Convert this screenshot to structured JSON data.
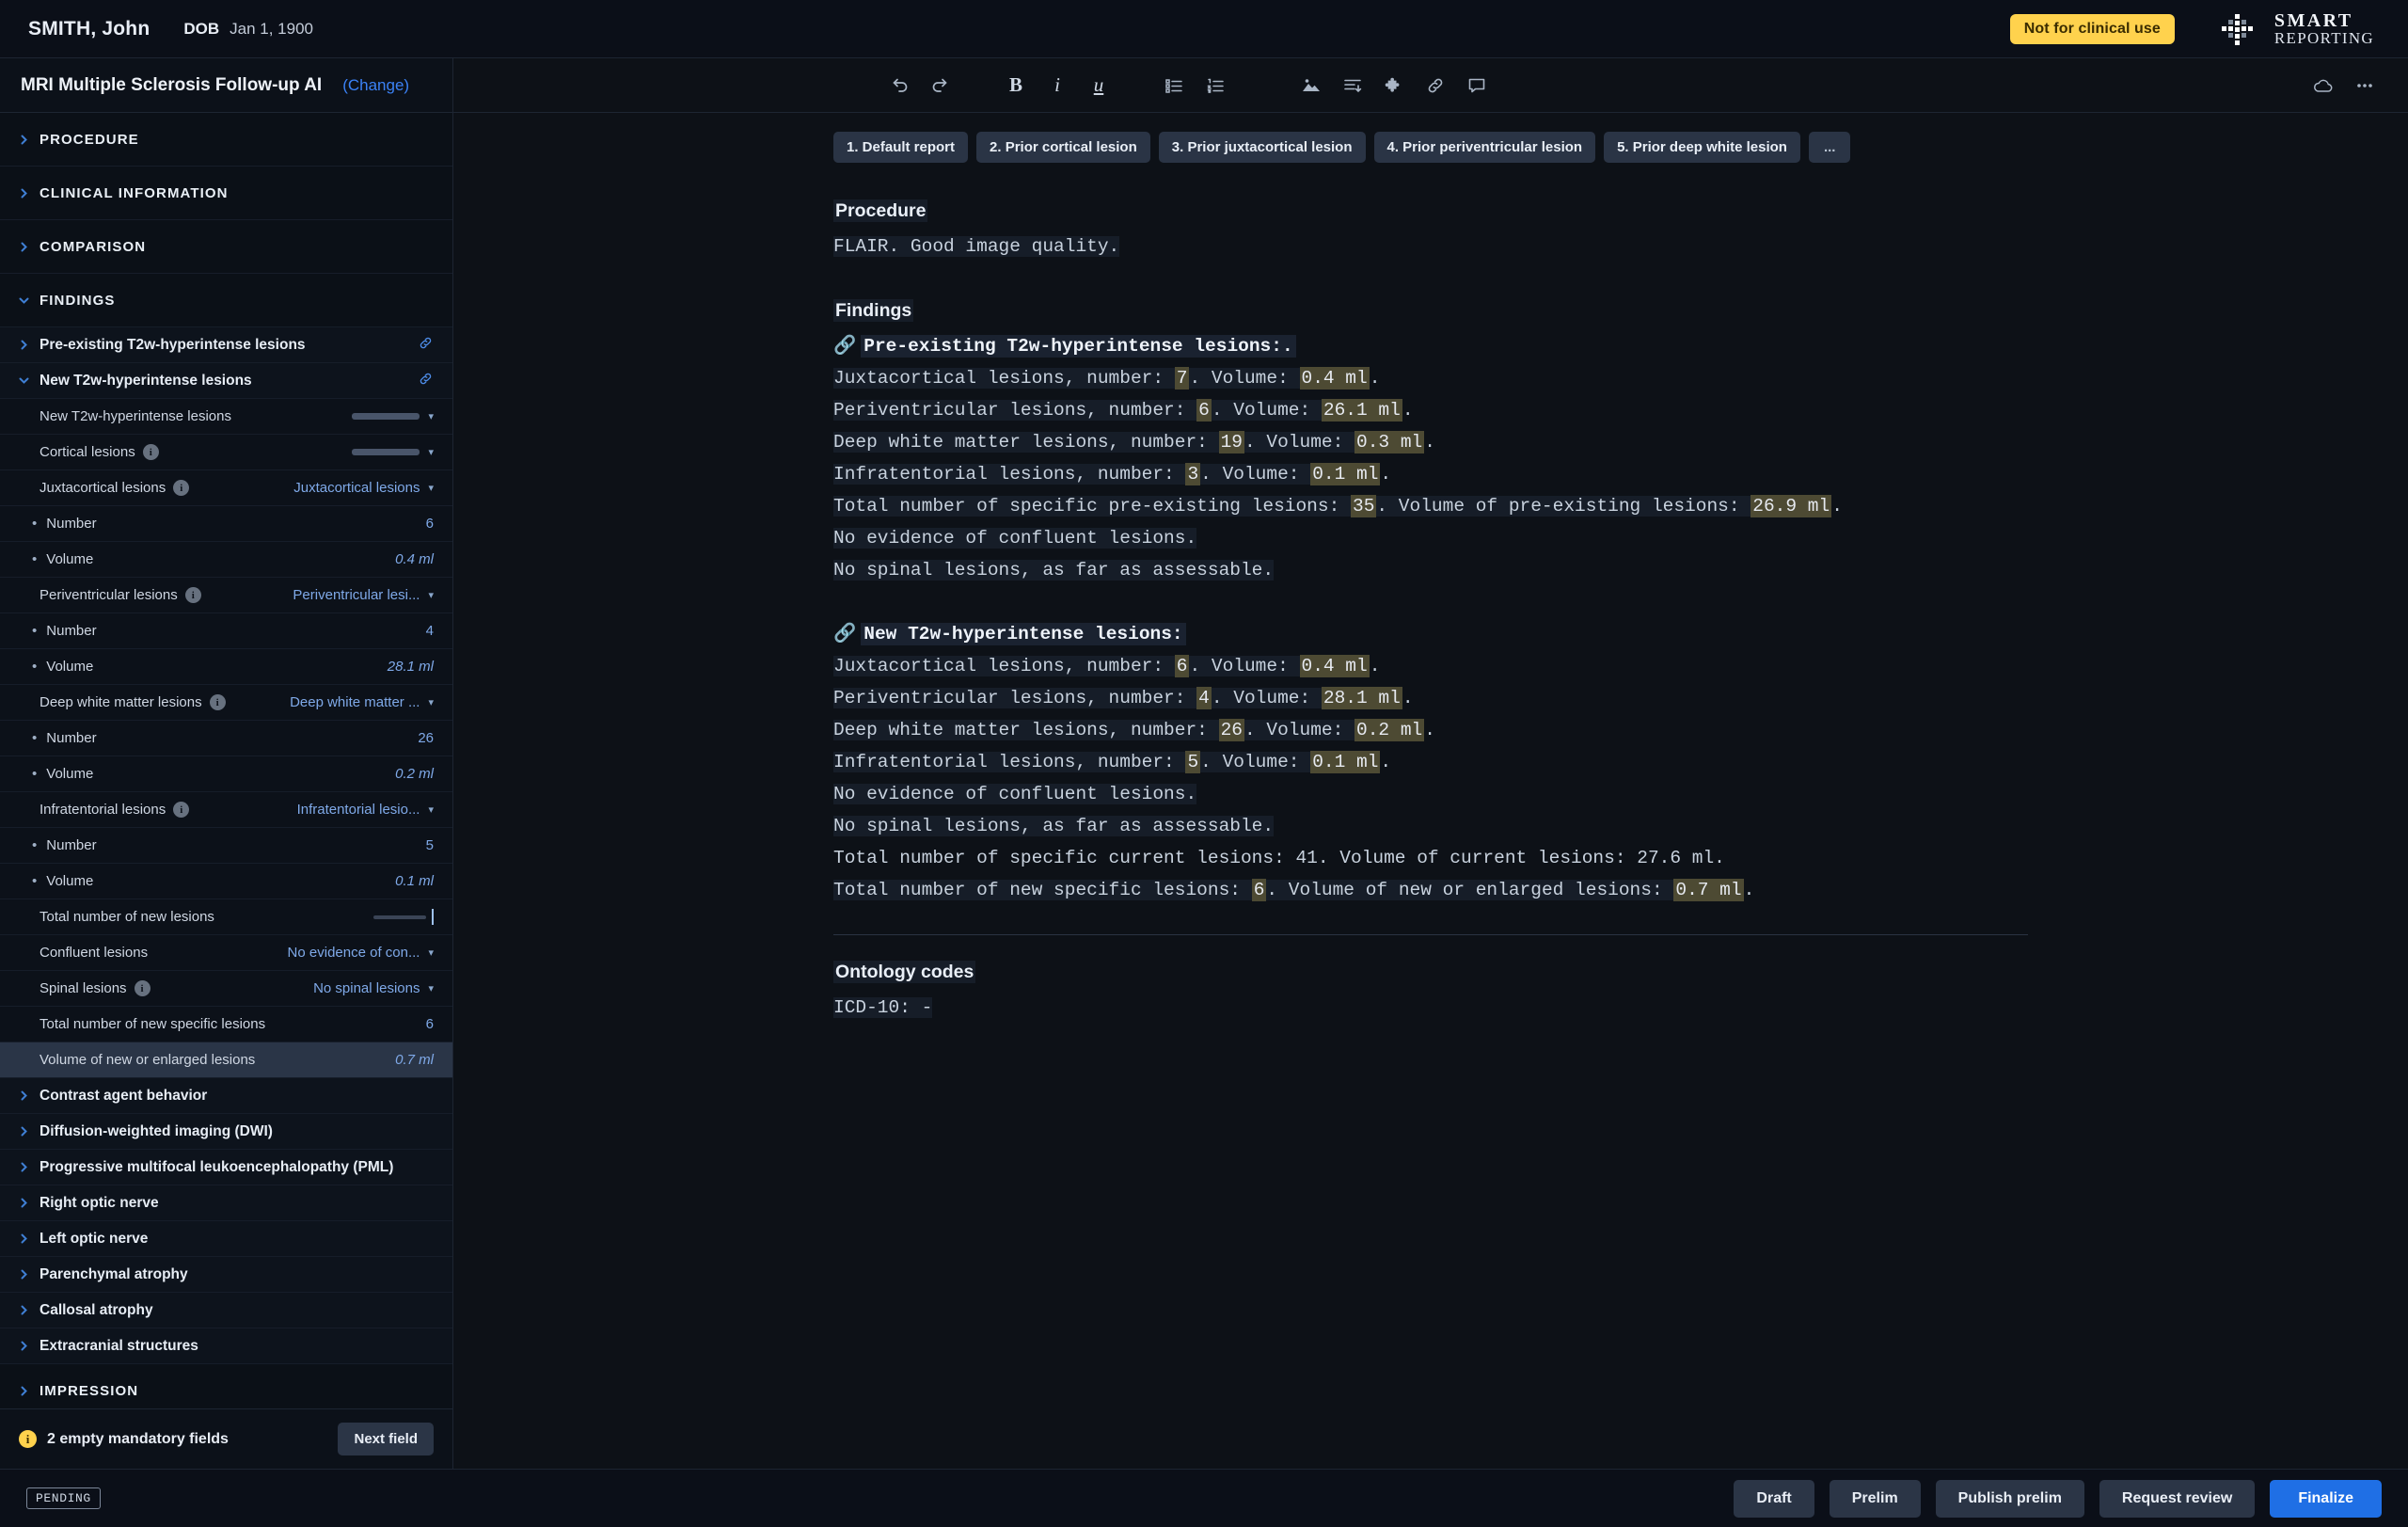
{
  "patient_bar": {
    "name": "SMITH, John",
    "dob_label": "DOB",
    "dob_value": "Jan 1, 1900",
    "clinical_badge": "Not for clinical use",
    "brand_line1": "SMART",
    "brand_line2": "REPORTING",
    "badge_color": "#ffd24d"
  },
  "sidebar": {
    "template_title": "MRI Multiple Sclerosis Follow-up AI",
    "change_label": "(Change)",
    "rows": [
      {
        "type": "section",
        "label": "PROCEDURE",
        "open": false
      },
      {
        "type": "section",
        "label": "CLINICAL INFORMATION",
        "open": false
      },
      {
        "type": "section",
        "label": "COMPARISON",
        "open": false
      },
      {
        "type": "section",
        "label": "FINDINGS",
        "open": true
      },
      {
        "type": "group",
        "label": "Pre-existing T2w-hyperintense lesions",
        "open": false,
        "link": true
      },
      {
        "type": "group",
        "label": "New T2w-hyperintense lesions",
        "open": true,
        "link": true
      },
      {
        "type": "field",
        "label": "New T2w-hyperintense lesions",
        "control": "empty-select"
      },
      {
        "type": "field",
        "label": "Cortical lesions",
        "info": true,
        "control": "empty-select"
      },
      {
        "type": "field",
        "label": "Juxtacortical lesions",
        "info": true,
        "control": "select",
        "value": "Juxtacortical lesions"
      },
      {
        "type": "sub",
        "label": "Number",
        "value": "6"
      },
      {
        "type": "sub",
        "label": "Volume",
        "value": "0.4 ml",
        "italic": true
      },
      {
        "type": "field",
        "label": "Periventricular lesions",
        "info": true,
        "control": "select",
        "value": "Periventricular lesi..."
      },
      {
        "type": "sub",
        "label": "Number",
        "value": "4"
      },
      {
        "type": "sub",
        "label": "Volume",
        "value": "28.1 ml",
        "italic": true
      },
      {
        "type": "field",
        "label": "Deep white matter lesions",
        "info": true,
        "control": "select",
        "value": "Deep white matter ..."
      },
      {
        "type": "sub",
        "label": "Number",
        "value": "26"
      },
      {
        "type": "sub",
        "label": "Volume",
        "value": "0.2 ml",
        "italic": true
      },
      {
        "type": "field",
        "label": "Infratentorial lesions",
        "info": true,
        "control": "select",
        "value": "Infratentorial lesio..."
      },
      {
        "type": "sub",
        "label": "Number",
        "value": "5"
      },
      {
        "type": "sub",
        "label": "Volume",
        "value": "0.1 ml",
        "italic": true
      },
      {
        "type": "field",
        "label": "Total number of new lesions",
        "control": "empty-input-focused"
      },
      {
        "type": "field",
        "label": "Confluent lesions",
        "control": "select",
        "value": "No evidence of con..."
      },
      {
        "type": "field",
        "label": "Spinal lesions",
        "info": true,
        "control": "select",
        "value": "No spinal lesions"
      },
      {
        "type": "field",
        "label": "Total number of new specific lesions",
        "value": "6"
      },
      {
        "type": "field",
        "label": "Volume of new or enlarged lesions",
        "value": "0.7 ml",
        "italic": true,
        "selected": true
      },
      {
        "type": "group",
        "label": "Contrast agent behavior",
        "open": false
      },
      {
        "type": "group",
        "label": "Diffusion-weighted imaging (DWI)",
        "open": false
      },
      {
        "type": "group",
        "label": "Progressive multifocal leukoencephalopathy (PML)",
        "open": false
      },
      {
        "type": "group",
        "label": "Right optic nerve",
        "open": false
      },
      {
        "type": "group",
        "label": "Left optic nerve",
        "open": false
      },
      {
        "type": "group",
        "label": "Parenchymal atrophy",
        "open": false
      },
      {
        "type": "group",
        "label": "Callosal atrophy",
        "open": false
      },
      {
        "type": "group",
        "label": "Extracranial structures",
        "open": false
      },
      {
        "type": "section",
        "label": "IMPRESSION",
        "open": false
      }
    ],
    "footer": {
      "warning_icon": "info-icon",
      "warning_text": "2 empty mandatory fields",
      "next_field_label": "Next field"
    }
  },
  "toolbar": {
    "icons": [
      "undo-icon",
      "redo-icon",
      "bold-icon",
      "italic-icon",
      "underline-icon",
      "bullet-list-icon",
      "numbered-list-icon",
      "image-icon",
      "indent-icon",
      "puzzle-icon",
      "link-icon",
      "comment-icon"
    ],
    "right_icons": [
      "cloud-icon",
      "more-options-icon"
    ]
  },
  "tabs": [
    {
      "label": "1. Default report"
    },
    {
      "label": "2. Prior cortical lesion"
    },
    {
      "label": "3. Prior juxtacortical lesion"
    },
    {
      "label": "4. Prior periventricular lesion"
    },
    {
      "label": "5. Prior deep white lesion"
    },
    {
      "label": "..."
    }
  ],
  "document": {
    "procedure_heading": "Procedure",
    "procedure_text": "FLAIR. Good image quality.",
    "findings_heading": "Findings",
    "pre_existing": {
      "title": "Pre-existing T2w-hyperintense lesions:.",
      "lines": [
        {
          "pre": "Juxtacortical lesions, number: ",
          "v1": "7",
          "mid": ". Volume: ",
          "v2": "0.4 ml",
          "post": "."
        },
        {
          "pre": "Periventricular lesions, number: ",
          "v1": "6",
          "mid": ". Volume: ",
          "v2": "26.1 ml",
          "post": "."
        },
        {
          "pre": "Deep white matter lesions, number: ",
          "v1": "19",
          "mid": ". Volume: ",
          "v2": "0.3 ml",
          "post": "."
        },
        {
          "pre": "Infratentorial lesions, number: ",
          "v1": "3",
          "mid": ". Volume: ",
          "v2": "0.1 ml",
          "post": "."
        },
        {
          "pre": "Total number of specific pre-existing lesions: ",
          "v1": "35",
          "mid": ". Volume of pre-existing lesions: ",
          "v2": "26.9 ml",
          "post": "."
        }
      ],
      "plain_lines": [
        "No evidence of confluent lesions.",
        "No spinal lesions, as far as assessable."
      ]
    },
    "new_lesions": {
      "title": "New T2w-hyperintense lesions:",
      "lines": [
        {
          "pre": "Juxtacortical lesions, number: ",
          "v1": "6",
          "mid": ". Volume: ",
          "v2": "0.4 ml",
          "post": "."
        },
        {
          "pre": "Periventricular lesions, number: ",
          "v1": "4",
          "mid": ". Volume: ",
          "v2": "28.1 ml",
          "post": "."
        },
        {
          "pre": "Deep white matter lesions, number: ",
          "v1": "26",
          "mid": ". Volume: ",
          "v2": "0.2 ml",
          "post": "."
        },
        {
          "pre": "Infratentorial lesions, number: ",
          "v1": "5",
          "mid": ". Volume: ",
          "v2": "0.1 ml",
          "post": "."
        }
      ],
      "plain_lines": [
        "No evidence of confluent lesions.",
        "No spinal lesions, as far as assessable.",
        "Total number of specific current lesions: 41. Volume of current lesions: 27.6 ml."
      ],
      "final_line": {
        "pre": "Total number of new specific lesions: ",
        "v1": "6",
        "mid": ". Volume of new or enlarged lesions: ",
        "v2": "0.7 ml",
        "post": "."
      }
    },
    "ontology_heading": "Ontology codes",
    "ontology_line": "ICD-10: -"
  },
  "footer": {
    "status": "PENDING",
    "buttons": [
      {
        "label": "Draft",
        "primary": false
      },
      {
        "label": "Prelim",
        "primary": false
      },
      {
        "label": "Publish prelim",
        "primary": false
      },
      {
        "label": "Request review",
        "primary": false
      },
      {
        "label": "Finalize",
        "primary": true
      }
    ],
    "primary_color": "#1f6fe5"
  }
}
